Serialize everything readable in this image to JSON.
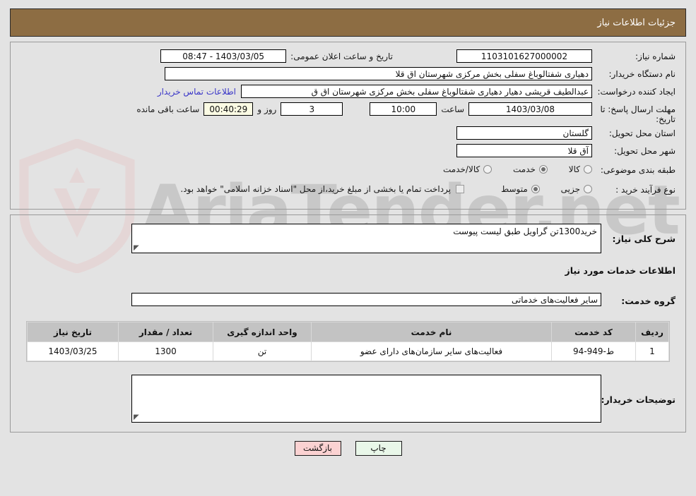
{
  "header": {
    "title": "جزئیات اطلاعات نیاز"
  },
  "colors": {
    "header_bar": "#8d6d43",
    "page_bg": "#e3e3e3",
    "link": "#3a36c8",
    "countdown_bg": "#fbfbe4",
    "table_header_bg": "#c3c3c3",
    "print_button_bg": "#e9f7e9",
    "back_button_bg": "#fbd2d2"
  },
  "watermark": {
    "text": "AriaTender.net"
  },
  "form": {
    "need_number_label": "شماره نیاز:",
    "need_number_value": "1103101627000002",
    "announce_datetime_label": "تاریخ و ساعت اعلان عمومی:",
    "announce_datetime_value": "1403/03/05 - 08:47",
    "buyer_org_label": "نام دستگاه خریدار:",
    "buyer_org_value": "دهیاری شفتالوباغ سفلی بخش مرکزی شهرستان اق قلا",
    "request_creator_label": "ایجاد کننده درخواست:",
    "request_creator_value": "عبدالطیف قریشی دهیار دهیاری شفتالوباغ سفلی بخش مرکزی شهرستان اق ق",
    "buyer_contact_link": "اطلاعات تماس خریدار",
    "deadline_label": "مهلت ارسال پاسخ: تا تاریخ:",
    "deadline_date": "1403/03/08",
    "deadline_hour_label": "ساعت",
    "deadline_hour_value": "10:00",
    "remaining_days_value": "3",
    "remaining_days_label": "روز و",
    "remaining_time_value": "00:40:29",
    "remaining_time_label": "ساعت باقی مانده",
    "province_label": "استان محل تحویل:",
    "province_value": "گلستان",
    "city_label": "شهر محل تحویل:",
    "city_value": "آق قلا",
    "classification_label": "طبقه بندی موضوعی:",
    "classification_options": [
      {
        "label": "کالا",
        "selected": false
      },
      {
        "label": "خدمت",
        "selected": true
      },
      {
        "label": "کالا/خدمت",
        "selected": false
      }
    ],
    "purchase_type_label": "نوع فرآیند خرید :",
    "purchase_type_options": [
      {
        "label": "جزیی",
        "selected": false
      },
      {
        "label": "متوسط",
        "selected": true
      }
    ],
    "treasury_checkbox_label": "پرداخت تمام یا بخشی از مبلغ خرید،از محل \"اسناد خزانه اسلامی\" خواهد بود.",
    "treasury_checkbox_checked": false
  },
  "description": {
    "label": "شرح کلی نیاز:",
    "value": "خرید1300تن گراویل طبق لیست پیوست"
  },
  "services_section": {
    "title": "اطلاعات خدمات مورد نیاز",
    "service_group_label": "گروه خدمت:",
    "service_group_value": "سایر فعالیت‌های خدماتی"
  },
  "table": {
    "columns": [
      "ردیف",
      "کد خدمت",
      "نام خدمت",
      "واحد اندازه گیری",
      "تعداد / مقدار",
      "تاریخ نیاز"
    ],
    "rows": [
      {
        "row_no": "1",
        "service_code": "ط-949-94",
        "service_name": "فعالیت‌های سایر سازمان‌های دارای عضو",
        "unit": "تن",
        "quantity": "1300",
        "need_date": "1403/03/25"
      }
    ]
  },
  "buyer_comments": {
    "label": "توضیحات خریدار:",
    "value": ""
  },
  "footer": {
    "print_label": "چاپ",
    "back_label": "بازگشت"
  }
}
